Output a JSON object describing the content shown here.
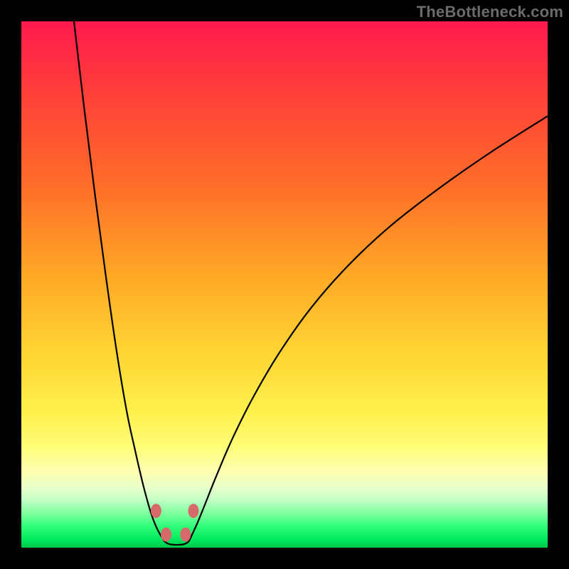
{
  "watermark": "TheBottleneck.com",
  "chart_data": {
    "type": "line",
    "title": "",
    "xlabel": "",
    "ylabel": "",
    "xlim": [
      0,
      100
    ],
    "ylim": [
      0,
      100
    ],
    "grid": false,
    "series": [
      {
        "name": "curve-left",
        "x": [
          10,
          12,
          14,
          16,
          18,
          20,
          21.5,
          23,
          24.2,
          25,
          25.7,
          26.2,
          26.8,
          27.2
        ],
        "y": [
          100,
          83,
          67,
          52,
          38,
          26,
          19,
          12.5,
          8,
          5.5,
          3.8,
          2.8,
          1.8,
          1.2
        ]
      },
      {
        "name": "valley-floor",
        "x": [
          27.2,
          28,
          29,
          30,
          31,
          31.8
        ],
        "y": [
          1.2,
          0.7,
          0.55,
          0.55,
          0.7,
          1.2
        ]
      },
      {
        "name": "curve-right",
        "x": [
          31.8,
          32.5,
          33.5,
          35,
          37,
          40,
          44,
          49,
          55,
          62,
          70,
          79,
          89,
          100
        ],
        "y": [
          1.2,
          2.6,
          4.8,
          8.5,
          13.5,
          20.5,
          28.5,
          37,
          45.5,
          53.5,
          61,
          68,
          75,
          82
        ]
      }
    ],
    "markers": [
      {
        "name": "left-upper",
        "x": 25.6,
        "y": 7.0
      },
      {
        "name": "left-lower",
        "x": 27.5,
        "y": 2.5
      },
      {
        "name": "right-lower",
        "x": 31.2,
        "y": 2.5
      },
      {
        "name": "right-upper",
        "x": 32.7,
        "y": 7.0
      }
    ],
    "marker_style": {
      "fill": "#d66a6a",
      "rx": 7.5,
      "ry": 10
    },
    "curve_style": {
      "stroke": "#000000",
      "stroke_width": 2.2
    }
  }
}
